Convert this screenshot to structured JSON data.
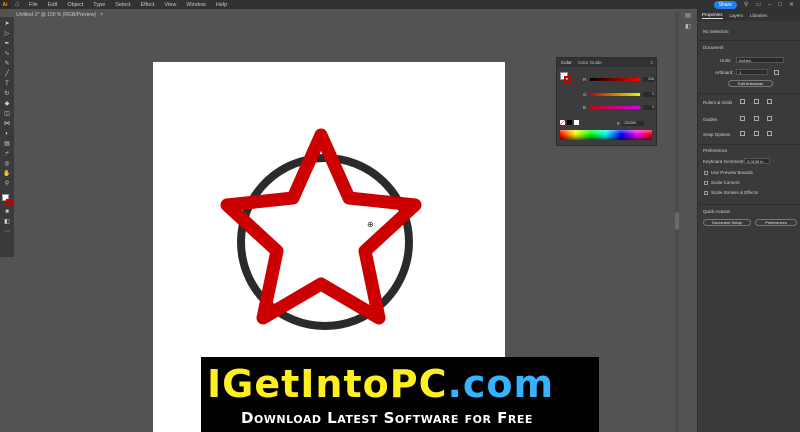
{
  "app": {
    "logo": "Ai",
    "menu": [
      "File",
      "Edit",
      "Object",
      "Type",
      "Select",
      "Effect",
      "View",
      "Window",
      "Help"
    ],
    "share_label": "Share"
  },
  "document": {
    "tab_title": "Untitled-1* @ 100 % (RGB/Preview)",
    "tab_close": "×"
  },
  "color_panel": {
    "tabs": [
      "Color",
      "Color Guide"
    ],
    "channels": [
      {
        "label": "R",
        "value": "206"
      },
      {
        "label": "G",
        "value": "0"
      },
      {
        "label": "B",
        "value": "0"
      }
    ],
    "hex_prefix": "#",
    "hex": "CE0000",
    "accent": "#ce0000"
  },
  "properties_panel": {
    "tabs": [
      "Properties",
      "Layers",
      "Libraries"
    ],
    "no_selection": "No Selection",
    "document_heading": "Document",
    "units_label": "Units:",
    "units_value": "Inches",
    "artboard_label": "Artboard:",
    "artboard_value": "1",
    "edit_artboards": "Edit Artboards",
    "rulers_grids": "Rulers & Grids",
    "guides": "Guides",
    "snap_options": "Snap Options",
    "preferences_heading": "Preferences",
    "keyboard_increment_label": "Keyboard Increment:",
    "keyboard_increment_value": "0.0139 in",
    "checkboxes": [
      "Use Preview Bounds",
      "Scale Corners",
      "Scale Strokes & Effects"
    ],
    "quick_actions": "Quick Actions",
    "document_setup": "Document Setup",
    "preferences_button": "Preferences"
  },
  "watermark": {
    "brand": "IGetIntoPC",
    "domain": ".com",
    "tagline": "Download Latest Software for Free"
  },
  "artwork": {
    "circle_color": "#2b2b2b",
    "star_color": "#cc0000"
  }
}
